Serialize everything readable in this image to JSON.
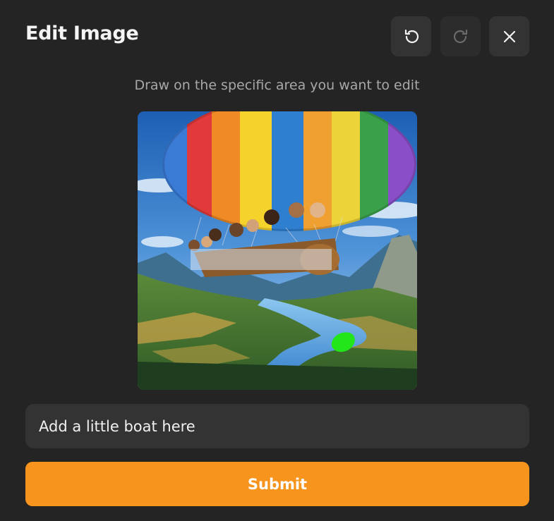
{
  "dialog": {
    "title": "Edit Image",
    "instruction": "Draw on the specific area you want to edit"
  },
  "toolbar": {
    "undo_icon": "undo-icon",
    "redo_icon": "redo-icon",
    "close_icon": "close-icon",
    "redo_enabled": false
  },
  "prompt": {
    "value": "Add a little boat here"
  },
  "submit": {
    "label": "Submit",
    "color": "#f7941d"
  },
  "mask": {
    "color": "#22e51a"
  }
}
